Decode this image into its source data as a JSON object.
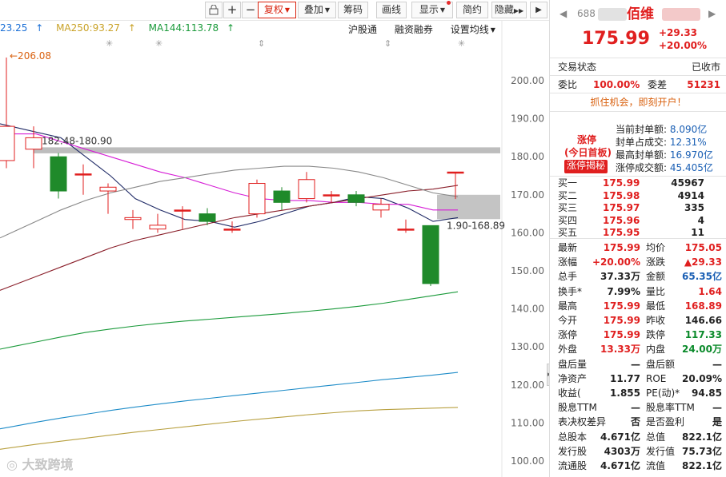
{
  "toolbar": {
    "buttons": [
      {
        "label": "复权",
        "active": true
      },
      {
        "label": "叠加"
      },
      {
        "label": "筹码"
      },
      {
        "label": "画线"
      },
      {
        "label": "显示"
      },
      {
        "label": "简约"
      },
      {
        "label": "隐藏"
      }
    ]
  },
  "ma_legend": {
    "ma_first": "23.25",
    "ma250": "MA250:93.27",
    "ma144": "MA144:113.78",
    "colors": {
      "ma_first": "#1a6fd6",
      "ma250": "#c9a227",
      "ma144": "#1a9a3a"
    }
  },
  "sub_menu": [
    "沪股通",
    "融资融券",
    "设置均线"
  ],
  "chart_annotations": {
    "high_label": "206.08",
    "zone1_label": "182.48-180.90",
    "zone2_label": "1.90-168.89"
  },
  "chart_data": {
    "type": "candlestick",
    "y_ticks": [
      "200.00",
      "190.00",
      "180.00",
      "170.00",
      "160.00",
      "150.00",
      "140.00",
      "130.00",
      "120.00",
      "110.00",
      "100.00"
    ],
    "ylim": [
      100,
      200
    ],
    "candles": [
      {
        "open": 179,
        "close": 188,
        "high": 206.08,
        "low": 177
      },
      {
        "open": 182,
        "close": 185,
        "high": 188,
        "low": 177
      },
      {
        "open": 180,
        "close": 171,
        "high": 181,
        "low": 169
      },
      {
        "open": 175.5,
        "close": 175.5,
        "high": 178,
        "low": 170
      },
      {
        "open": 171,
        "close": 172,
        "high": 173,
        "low": 165
      },
      {
        "open": 163.5,
        "close": 164,
        "high": 166,
        "low": 161
      },
      {
        "open": 161,
        "close": 162,
        "high": 165,
        "low": 160
      },
      {
        "open": 166,
        "close": 166,
        "high": 167,
        "low": 161
      },
      {
        "open": 165,
        "close": 163,
        "high": 166.5,
        "low": 162
      },
      {
        "open": 161,
        "close": 161,
        "high": 163,
        "low": 160
      },
      {
        "open": 165,
        "close": 173,
        "high": 174,
        "low": 164
      },
      {
        "open": 171,
        "close": 168,
        "high": 172,
        "low": 166
      },
      {
        "open": 169,
        "close": 174,
        "high": 176,
        "low": 168
      },
      {
        "open": 170,
        "close": 170,
        "high": 171,
        "low": 168
      },
      {
        "open": 170,
        "close": 168,
        "high": 171,
        "low": 167
      },
      {
        "open": 166,
        "close": 167.5,
        "high": 169,
        "low": 164
      },
      {
        "open": 161,
        "close": 161,
        "high": 163.5,
        "low": 160
      },
      {
        "open": 161.9,
        "close": 146.66,
        "high": 161.9,
        "low": 146
      },
      {
        "open": 175.99,
        "close": 175.99,
        "high": 175.99,
        "low": 168.89
      }
    ],
    "series": [
      {
        "name": "MA5",
        "color": "#1f2a66",
        "values": [
          null,
          186.5,
          185,
          180,
          175,
          169,
          166,
          163.5,
          163,
          161.5,
          163,
          165,
          167,
          168,
          169.5,
          169,
          166.5,
          163,
          164
        ]
      },
      {
        "name": "MA10",
        "color": "#d61dd6",
        "values": [
          186,
          186,
          184,
          182,
          180,
          178,
          176,
          174.5,
          172.5,
          170.5,
          169,
          168.5,
          168.5,
          168,
          168,
          167.5,
          167.5,
          166,
          166
        ]
      },
      {
        "name": "MA20",
        "color": "#8a1f2a",
        "values": [
          146,
          148.5,
          151,
          153.5,
          156,
          158,
          159.5,
          161,
          162.5,
          164,
          165,
          166,
          167,
          168,
          169,
          170,
          171,
          171.5,
          172.5
        ]
      },
      {
        "name": "MA60",
        "color": "#888888",
        "values": [
          160,
          163,
          166,
          168.5,
          170.5,
          172,
          173.5,
          174.5,
          175.5,
          176.5,
          177,
          177.5,
          177.5,
          177,
          176,
          174.5,
          172.5,
          170.5,
          169.5
        ]
      },
      {
        "name": "MA120",
        "color": "#1a9a3a",
        "values": [
          130,
          131.3,
          132.6,
          133.8,
          134.7,
          135.5,
          136.2,
          136.8,
          137.3,
          137.8,
          138.3,
          138.8,
          139.4,
          140,
          140.7,
          141.5,
          142.5,
          143.5,
          144.5
        ]
      },
      {
        "name": "MA144",
        "color": "#1e8cc8",
        "values": [
          109,
          110.2,
          111.3,
          112.3,
          113.3,
          114.2,
          115,
          115.8,
          116.5,
          117.2,
          117.9,
          118.6,
          119.3,
          120,
          120.7,
          121.4,
          122,
          122.6,
          123.3
        ]
      },
      {
        "name": "MA250",
        "color": "#b8a040",
        "values": [
          103.5,
          104.4,
          105.2,
          106,
          106.8,
          107.6,
          108.3,
          109,
          109.7,
          110.4,
          111,
          111.6,
          112.2,
          112.7,
          113.2,
          113.5,
          113.7,
          113.9,
          114.1
        ]
      }
    ]
  },
  "side": {
    "code": "688",
    "name": "佰维",
    "price": "175.99",
    "change": "+29.33",
    "change_pct": "+20.00%",
    "status_label": "交易状态",
    "status_value": "已收市",
    "weibi_label": "委比",
    "weibi_value": "100.00%",
    "weicha_label": "委差",
    "weicha_value": "51231",
    "promo": "抓住机会，即刻开户！",
    "limit": {
      "title": "涨停",
      "sub": "(今日首板)",
      "tag": "涨停揭秘",
      "items": [
        {
          "label": "当前封单额:",
          "value": "8.090亿"
        },
        {
          "label": "封单占成交:",
          "value": "12.31%"
        },
        {
          "label": "最高封单额:",
          "value": "16.970亿"
        },
        {
          "label": "涨停成交额:",
          "value": "45.405亿"
        }
      ]
    },
    "bids": [
      {
        "label": "买一",
        "price": "175.99",
        "vol": "45967"
      },
      {
        "label": "买二",
        "price": "175.98",
        "vol": "4914"
      },
      {
        "label": "买三",
        "price": "175.97",
        "vol": "335"
      },
      {
        "label": "买四",
        "price": "175.96",
        "vol": "4"
      },
      {
        "label": "买五",
        "price": "175.95",
        "vol": "11"
      }
    ],
    "stats": [
      {
        "l1": "最新",
        "v1": "175.99",
        "c1": "red",
        "l2": "均价",
        "v2": "175.05",
        "c2": "red"
      },
      {
        "l1": "涨幅",
        "v1": "+20.00%",
        "c1": "red",
        "l2": "涨跌",
        "v2": "▲29.33",
        "c2": "red"
      },
      {
        "l1": "总手",
        "v1": "37.33万",
        "c1": "",
        "l2": "金额",
        "v2": "65.35亿",
        "c2": "blue"
      },
      {
        "l1": "换手*",
        "v1": "7.99%",
        "c1": "",
        "l2": "量比",
        "v2": "1.64",
        "c2": "red"
      },
      {
        "l1": "最高",
        "v1": "175.99",
        "c1": "red",
        "l2": "最低",
        "v2": "168.89",
        "c2": "red"
      },
      {
        "l1": "今开",
        "v1": "175.99",
        "c1": "red",
        "l2": "昨收",
        "v2": "146.66",
        "c2": ""
      },
      {
        "l1": "涨停",
        "v1": "175.99",
        "c1": "red",
        "l2": "跌停",
        "v2": "117.33",
        "c2": "green"
      },
      {
        "l1": "外盘",
        "v1": "13.33万",
        "c1": "red",
        "l2": "内盘",
        "v2": "24.00万",
        "c2": "green"
      },
      {
        "l1": "盘后量",
        "v1": "—",
        "c1": "",
        "l2": "盘后额",
        "v2": "—",
        "c2": ""
      },
      {
        "l1": "净资产",
        "v1": "11.77",
        "c1": "",
        "l2": "ROE",
        "v2": "20.09%",
        "c2": ""
      },
      {
        "l1": "收益(",
        "v1": "1.855",
        "c1": "",
        "l2": "PE(动)*",
        "v2": "94.85",
        "c2": ""
      },
      {
        "l1": "股息TTM",
        "v1": "—",
        "c1": "",
        "l2": "股息率TTM",
        "v2": "—",
        "c2": ""
      },
      {
        "l1": "表决权差异",
        "v1": "否",
        "c1": "",
        "l2": "是否盈利",
        "v2": "是",
        "c2": ""
      },
      {
        "l1": "总股本",
        "v1": "4.671亿",
        "c1": "",
        "l2": "总值",
        "v2": "822.1亿",
        "c2": ""
      },
      {
        "l1": "发行股",
        "v1": "4303万",
        "c1": "",
        "l2": "发行值",
        "v2": "75.73亿",
        "c2": ""
      },
      {
        "l1": "流通股",
        "v1": "4.671亿",
        "c1": "",
        "l2": "流值",
        "v2": "822.1亿",
        "c2": ""
      }
    ]
  },
  "watermark": "大致跨境"
}
